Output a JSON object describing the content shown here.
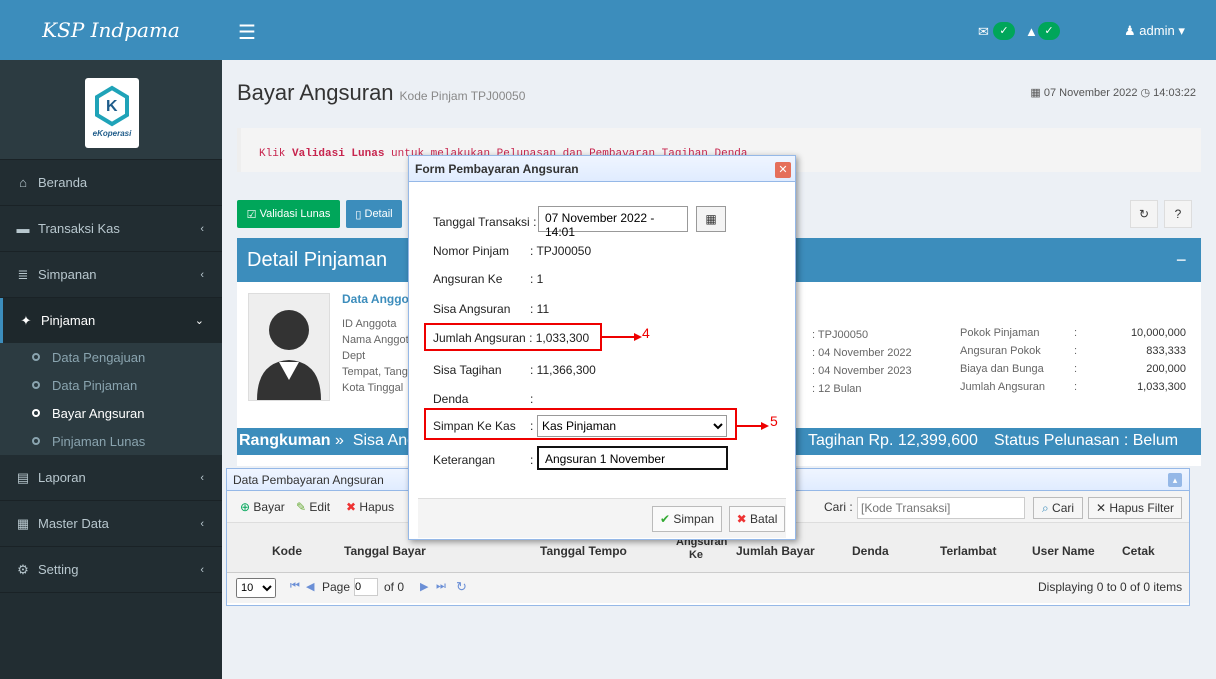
{
  "brand": "KSP Indpama",
  "logo_text": "eKoperasi",
  "user": "admin",
  "nav": [
    {
      "label": "Beranda"
    },
    {
      "label": "Transaksi Kas"
    },
    {
      "label": "Simpanan"
    },
    {
      "label": "Pinjaman"
    },
    {
      "label": "Laporan"
    },
    {
      "label": "Master Data"
    },
    {
      "label": "Setting"
    }
  ],
  "subnav": [
    "Data Pengajuan",
    "Data Pinjaman",
    "Bayar Angsuran",
    "Pinjaman Lunas"
  ],
  "page": {
    "title": "Bayar Angsuran",
    "subtitle": "Kode Pinjam TPJ00050",
    "date": "07 November 2022",
    "time": "14:03:22"
  },
  "callout": {
    "pre": "Klik ",
    "bold": "Validasi Lunas",
    "post": " untuk melakukan Pelunasan dan Pembayaran Tagihan Denda"
  },
  "buttons": {
    "validasi": "Validasi Lunas",
    "detail": "Detail"
  },
  "detail": {
    "title": "Detail Pinjaman",
    "anggota_title": "Data Anggota",
    "labels": [
      "ID Anggota",
      "Nama Anggota",
      "Dept",
      "Tempat, Tanggal Lahir",
      "Kota Tinggal"
    ],
    "mid": [
      ": TPJ00050",
      ": 04 November 2022",
      ": 04 November 2023",
      ": 12 Bulan"
    ],
    "right_labels": [
      "Pokok Pinjaman",
      "Angsuran Pokok",
      "Biaya dan Bunga",
      "Jumlah Angsuran"
    ],
    "right_values": [
      "10,000,000",
      "833,333",
      "200,000",
      "1,033,300"
    ]
  },
  "summary": {
    "label": "Rangkuman",
    "arrow": "»",
    "sisa": "Sisa Angsuran",
    "tagihan": "Tagihan Rp. 12,399,600",
    "status": "Status Pelunasan : Belum"
  },
  "grid": {
    "title": "Data Pembayaran Angsuran",
    "tools": [
      "Bayar",
      "Edit",
      "Hapus"
    ],
    "search_label": "Cari :",
    "search_placeholder": "[Kode Transaksi]",
    "search_btn": "Cari",
    "clear_btn": "Hapus Filter",
    "cols": [
      "Kode",
      "Tanggal Bayar",
      "Tanggal Tempo",
      "Angsuran Ke",
      "Jumlah Bayar",
      "Denda",
      "Terlambat",
      "User Name",
      "Cetak"
    ],
    "page_size": "10",
    "page_label": "Page",
    "page_value": "0",
    "of_label": "of 0",
    "display": "Displaying 0 to 0 of 0 items"
  },
  "modal": {
    "title": "Form Pembayaran Angsuran",
    "rows": [
      {
        "label": "Tanggal Transaksi",
        "value": "07 November 2022 - 14:01"
      },
      {
        "label": "Nomor Pinjam",
        "value": "TPJ00050"
      },
      {
        "label": "Angsuran Ke",
        "value": "1"
      },
      {
        "label": "Sisa Angsuran",
        "value": "11"
      },
      {
        "label": "Jumlah Angsuran",
        "value": "1,033,300"
      },
      {
        "label": "Sisa Tagihan",
        "value": "11,366,300"
      },
      {
        "label": "Denda",
        "value": ""
      },
      {
        "label": "Simpan Ke Kas",
        "value": "Kas Pinjaman"
      },
      {
        "label": "Keterangan",
        "value": "Angsuran 1 November"
      }
    ],
    "save": "Simpan",
    "cancel": "Batal",
    "annot4": "4",
    "annot5": "5"
  }
}
